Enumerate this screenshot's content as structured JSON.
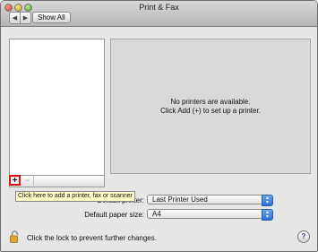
{
  "window": {
    "title": "Print & Fax"
  },
  "toolbar": {
    "back_glyph": "◀",
    "forward_glyph": "▶",
    "show_all_label": "Show All"
  },
  "printer_list": {
    "add_glyph": "+",
    "remove_glyph": "−"
  },
  "empty_state": {
    "line1": "No printers are available.",
    "line2": "Click Add (+) to set up a printer."
  },
  "tooltip": {
    "text": "Click here to add a printer, fax or scanner"
  },
  "default_printer": {
    "label": "Default printer:",
    "label_visible": "Default printer:",
    "value": "Last Printer Used"
  },
  "default_paper": {
    "label": "Default paper size:",
    "value": "A4"
  },
  "footer": {
    "lock_text": "Click the lock to prevent further changes.",
    "help_glyph": "?"
  },
  "colors": {
    "highlight": "#e31010",
    "tooltip_bg": "#ffffc7",
    "popup_arrow": "#2a6fcf"
  },
  "icons": {
    "lock": "lock-icon",
    "help": "help-icon"
  }
}
